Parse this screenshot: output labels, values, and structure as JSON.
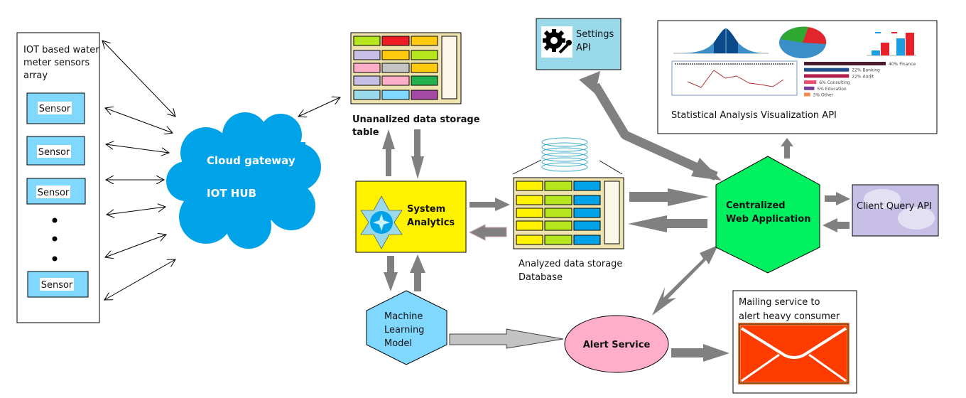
{
  "sensor_array": {
    "title_lines": [
      "IOT based water",
      "meter sensors",
      "array"
    ],
    "sensors": [
      "Sensor",
      "Sensor",
      "Sensor",
      "Sensor"
    ],
    "ellipsis_dots": 3
  },
  "cloud_gateway": {
    "line1": "Cloud gateway",
    "line2": "IOT HUB"
  },
  "unanalyzed_storage": {
    "label_lines": [
      "Unanalized data storage",
      "table"
    ],
    "cell_colors": [
      [
        "#b5e61d",
        "#ed1c24",
        "#ffc90e"
      ],
      [
        "#c8bfe7",
        "#ffc90e",
        "#b5e61d"
      ],
      [
        "#ffaec9",
        "#c3c3c3",
        "#ffc90e"
      ],
      [
        "#c8bfe7",
        "#ffaec9",
        "#22b14c"
      ],
      [
        "#99d9ea",
        "#80d8ff",
        "#a349a4"
      ]
    ]
  },
  "system_analytics": {
    "label_lines": [
      "System",
      "Analytics"
    ]
  },
  "ml_model": {
    "label_lines": [
      "Machine",
      "Learning",
      "Model"
    ]
  },
  "analyzed_storage": {
    "label_lines": [
      "Analyzed data storage",
      "Database"
    ],
    "cell_colors": [
      [
        "#fff200",
        "#b5e61d",
        "#00a2e8"
      ],
      [
        "#fff200",
        "#b5e61d",
        "#00a2e8"
      ],
      [
        "#fff200",
        "#b5e61d",
        "#00a2e8"
      ],
      [
        "#fff200",
        "#b5e61d",
        "#00a2e8"
      ],
      [
        "#fff200",
        "#b5e61d",
        "#00a2e8"
      ]
    ]
  },
  "settings_api": {
    "label_lines": [
      "Settings",
      "API"
    ]
  },
  "stats_api": {
    "label": "Statistical Analysis Visualization API",
    "thumb_bar_legend": [
      {
        "pct": "40%",
        "name": "Finance",
        "color": "#4a1c2c"
      },
      {
        "pct": "22%",
        "name": "Banking",
        "color": "#1f4e8c"
      },
      {
        "pct": "22%",
        "name": "Audit",
        "color": "#b0204a"
      },
      {
        "pct": "6%",
        "name": "Consulting",
        "color": "#e8506e"
      },
      {
        "pct": "5%",
        "name": "Education",
        "color": "#7b3a96"
      },
      {
        "pct": "3%",
        "name": "Other",
        "color": "#f0884a"
      }
    ]
  },
  "web_app": {
    "label_lines": [
      "Centralized",
      "Web Application"
    ]
  },
  "client_query_api": {
    "label": "Client Query API"
  },
  "alert_service": {
    "label": "Alert Service"
  },
  "mailing_service": {
    "label_lines": [
      "Mailing service to",
      "alert heavy consumer"
    ]
  },
  "colors": {
    "sensor_fill": "#80d8ff",
    "cloud": "#00a2e8",
    "analytics_fill": "#fff200",
    "ml_fill": "#80d8ff",
    "settings_fill": "#99d9ea",
    "web_app_fill": "#00f060",
    "client_api_fill": "#c8bfe7",
    "alert_fill": "#ffaec9",
    "envelope": "#ff3c00",
    "envelope_border": "#f0803c",
    "storage_frame": "#efe4b0",
    "arrow_gray": "#808080"
  }
}
